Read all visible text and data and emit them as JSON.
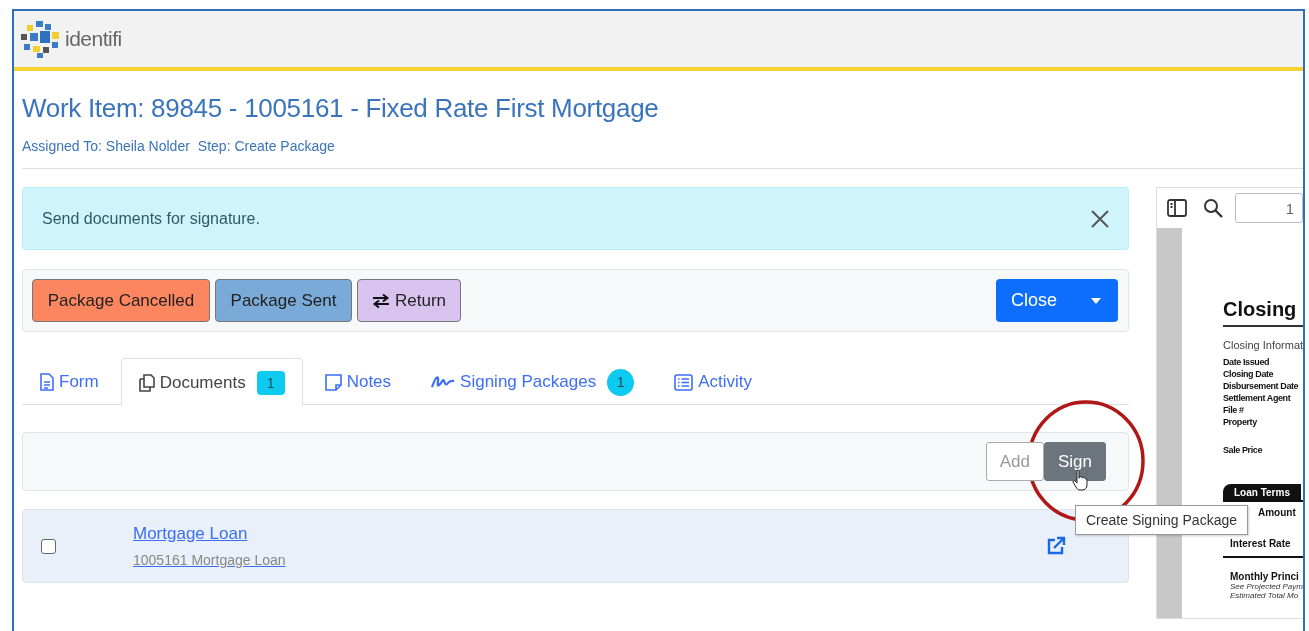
{
  "app": {
    "logo_text": "identifi"
  },
  "header": {
    "title": "Work Item: 89845 - 1005161 - Fixed Rate First Mortgage",
    "assigned": "Assigned To: Sheila Nolder",
    "step": "Step: Create Package"
  },
  "alert": {
    "message": "Send documents for signature."
  },
  "actions": [
    {
      "label": "Package Cancelled",
      "kind": "cancelled"
    },
    {
      "label": "Package Sent",
      "kind": "sent"
    },
    {
      "label": "Return",
      "kind": "return"
    }
  ],
  "close_button": {
    "label": "Close"
  },
  "tabs": [
    {
      "label": "Form",
      "kind": "form",
      "selected": false
    },
    {
      "label": "Documents",
      "kind": "documents",
      "badge": "1",
      "selected": true
    },
    {
      "label": "Notes",
      "kind": "notes",
      "selected": false
    },
    {
      "label": "Signing Packages",
      "kind": "signing",
      "badge": "1",
      "selected": false
    },
    {
      "label": "Activity",
      "kind": "activity",
      "selected": false
    }
  ],
  "toolbar": {
    "buttons": [
      {
        "label": "Add",
        "kind": "outline"
      },
      {
        "label": "Sign",
        "kind": "filled"
      }
    ],
    "tooltip": "Create Signing Package"
  },
  "documents": [
    {
      "title": "Mortgage Loan",
      "subtitle": "1005161 Mortgage Loan",
      "checked": false
    }
  ],
  "viewer": {
    "page": "1",
    "doc_title": "Closing",
    "section": "Closing Informat",
    "fields": [
      "Date Issued",
      "Closing Date",
      "Disbursement Date",
      "Settlement Agent",
      "File #",
      "Property"
    ],
    "sale_price": "Sale Price",
    "loan_terms": "Loan Terms",
    "amount": "Amount",
    "interest_rate": "Interest Rate",
    "monthly": "Monthly Princi",
    "notes": [
      "See Projected Paym",
      "Estimated Total Mo"
    ]
  }
}
